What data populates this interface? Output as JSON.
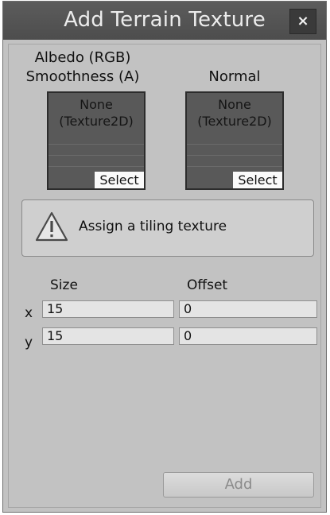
{
  "window": {
    "title": "Add Terrain Texture",
    "close_label": "×"
  },
  "slots": [
    {
      "label_line1": "Albedo (RGB)",
      "label_line2": "Smoothness (A)",
      "value_line1": "None",
      "value_line2": "(Texture2D)",
      "select_label": "Select"
    },
    {
      "label_line1": "Normal",
      "value_line1": "None",
      "value_line2": "(Texture2D)",
      "select_label": "Select"
    }
  ],
  "help": {
    "icon": "warning-icon",
    "message": "Assign a tiling texture"
  },
  "tiling": {
    "size_header": "Size",
    "offset_header": "Offset",
    "x_label": "x",
    "y_label": "y",
    "size_x": "15",
    "size_y": "15",
    "offset_x": "0",
    "offset_y": "0"
  },
  "footer": {
    "add_label": "Add"
  }
}
